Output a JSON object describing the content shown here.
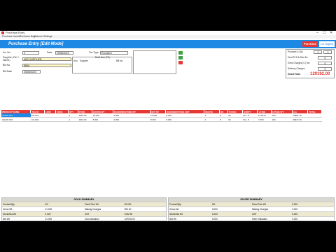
{
  "window": {
    "title": "Purchase Entry",
    "min": "–",
    "max": "☐",
    "close": "✕"
  },
  "menu": [
    "Purchase Invoice",
    "Purchase Bags",
    "Column Settings"
  ],
  "header": {
    "title": "Purchase Entry [Edit Mode]",
    "purchase_btn": "Purchase",
    "tagging_btn": "Lot Tagging"
  },
  "form": {
    "inv_no_label": "Inv. No",
    "inv_no": "2",
    "date_label": "Date",
    "date": "25/08/2023",
    "tax_type_label": "Tax Type",
    "tax_type": "Exclusive",
    "supplier_label": "Supplier (Ctrl + Name)",
    "supplier": "ABC SUPPLIER",
    "bill_no_label": "Bill No",
    "bill_no": "8554",
    "bill_date_label": "Bill Date",
    "bill_date": "25/08/2023",
    "grid_small_title": "Draft Item (F2)",
    "grid_small_cols": [
      "Sno",
      "Supplier",
      "Bill No"
    ]
  },
  "totals": {
    "products_qty_label": "Products & Qty",
    "products": "2",
    "qty": "2",
    "zero_label": "Zero/TCS & Disc Ex.",
    "zero": "0",
    "extra_label": "Extra Charges (C) Tax",
    "extra": "0",
    "delivery_label": "Delivery Charges",
    "delivery": "0",
    "grand_label": "Grand Total",
    "grand": "129192.00"
  },
  "accent": {
    "header": "#1e88e5",
    "table_head": "#e53935",
    "grand": "#e53935"
  },
  "grid": {
    "columns": [
      "PRODUCT NAME",
      "TAG ID",
      "HUID",
      "DESC",
      "QTY",
      "PURE",
      "GROSS WT",
      "DIAMOND/STONE WT",
      "NET WT",
      "DIAMOND/STONE AMT",
      "WASTG",
      "MC",
      "TOUCH",
      "SURITY",
      "V.FINE",
      "F.PURE WT",
      "ALL",
      "TOTAL"
    ],
    "rows": [
      [
        "CHAIN 916",
        "CH-001",
        "",
        "",
        "1",
        "1010.00",
        "12.000",
        "0.000",
        "12.000",
        "0.000",
        "0",
        "8",
        "92",
        "92 + 8",
        "11.0176",
        "100",
        "74881.10",
        ""
      ],
      [
        "CHAIN 916",
        "CH-002",
        "",
        "",
        "1",
        "1010.00",
        "8.000",
        "0.000",
        "8.000",
        "0.000",
        "0",
        "8",
        "92",
        "92 + 8",
        "7.360",
        "100",
        "52947.90",
        ""
      ]
    ]
  },
  "gold_summary": {
    "title": "GOLD SUMMARY",
    "rows": [
      [
        "Product/Qty",
        "2/2",
        "Fixed Fine Wt",
        "20.000"
      ],
      [
        "Gross Wt",
        "21.000",
        "Making Charges",
        "900.00"
      ],
      [
        "Stone/Dia Wt",
        "0.000",
        "GST",
        "3762.90"
      ],
      [
        "Net Wt",
        "21.000",
        "Gold Valuation",
        "129192.00"
      ]
    ]
  },
  "silver_summary": {
    "title": "SILVER SUMMARY",
    "rows": [
      [
        "Product/Qty",
        "0/0",
        "Fixed Fine Wt",
        "0.000"
      ],
      [
        "Gross Wt",
        "0.000",
        "Making Charges",
        "0.000"
      ],
      [
        "Stone/Dia Wt",
        "0.000",
        "GST",
        "0.000"
      ],
      [
        "Net Wt",
        "0.000",
        "Silver Valuation",
        "0.000"
      ]
    ]
  }
}
